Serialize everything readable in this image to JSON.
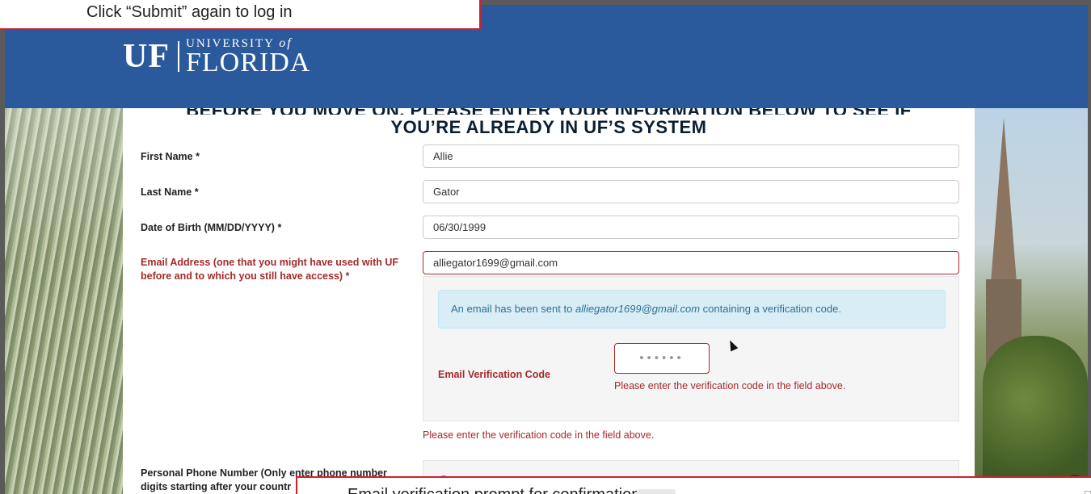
{
  "overlay": {
    "instruction": "Click “Submit” again to log in",
    "caption": "Email verification prompt for confirmation"
  },
  "header": {
    "logo_uf": "UF",
    "logo_university": "UNIVERSITY",
    "logo_of": "of",
    "logo_florida": "FLORIDA"
  },
  "form": {
    "heading_partial": "BEFORE YOU MOVE ON, PLEASE ENTER YOUR INFORMATION BELOW TO SEE IF",
    "heading": "YOU’RE ALREADY IN UF’S SYSTEM",
    "first_name_label": "First Name *",
    "first_name_value": "Allie",
    "last_name_label": "Last Name *",
    "last_name_value": "Gator",
    "dob_label": "Date of Birth (MM/DD/YYYY) *",
    "dob_value": "06/30/1999",
    "email_label": "Email Address (one that you might have used with UF before and to which you still have access) *",
    "email_value": "alliegator1699@gmail.com",
    "alert_prefix": "An email has been sent to ",
    "alert_email": "alliegator1699@gmail.com",
    "alert_suffix": " containing a verification code.",
    "code_label": "Email Verification Code",
    "code_value": "••••••",
    "code_help": "Please enter the verification code in the field above.",
    "email_help": "Please enter the verification code in the field above.",
    "phone_label": "Personal Phone Number (Only enter phone number digits starting after your countr"
  }
}
